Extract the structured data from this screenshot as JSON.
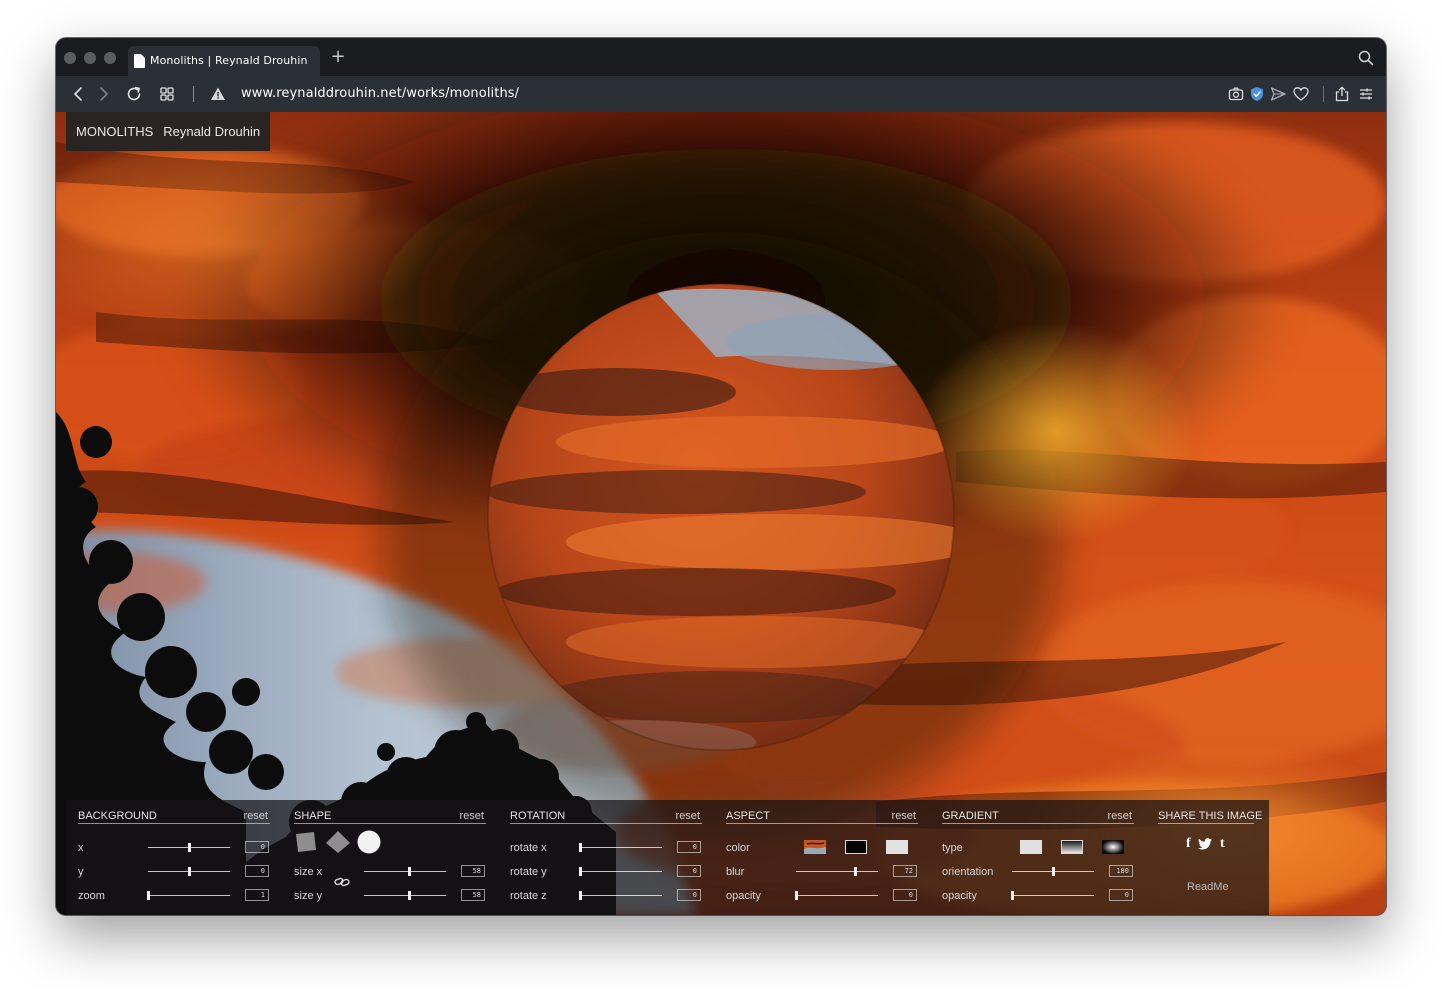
{
  "browser": {
    "tab_title": "Monoliths | Reynald Drouhin",
    "new_tab_label": "+",
    "url": "www.reynalddrouhin.net/works/monoliths/"
  },
  "site": {
    "title": "MONOLITHS",
    "author": "Reynald Drouhin"
  },
  "controls": {
    "background": {
      "title": "BACKGROUND",
      "reset": "reset",
      "rows": [
        {
          "label": "x",
          "value": "0",
          "level": 0.5
        },
        {
          "label": "y",
          "value": "0",
          "level": 0.5
        },
        {
          "label": "zoom",
          "value": "1",
          "level": 0.0
        }
      ]
    },
    "shape": {
      "title": "SHAPE",
      "reset": "reset",
      "shapes": [
        "square",
        "diamond",
        "circle"
      ],
      "selected_shape": "circle",
      "rows": [
        {
          "label": "size x",
          "value": "58",
          "level": 0.55
        },
        {
          "label": "size y",
          "value": "58",
          "level": 0.55
        }
      ]
    },
    "rotation": {
      "title": "ROTATION",
      "reset": "reset",
      "rows": [
        {
          "label": "rotate x",
          "value": "0",
          "level": 0.0
        },
        {
          "label": "rotate y",
          "value": "0",
          "level": 0.0
        },
        {
          "label": "rotate z",
          "value": "0",
          "level": 0.0
        }
      ]
    },
    "aspect": {
      "title": "ASPECT",
      "reset": "reset",
      "color_label": "color",
      "color_options": [
        "image",
        "black",
        "white"
      ],
      "rows": [
        {
          "label": "blur",
          "value": "72",
          "level": 0.72
        },
        {
          "label": "opacity",
          "value": "0",
          "level": 0.0
        }
      ]
    },
    "gradient": {
      "title": "GRADIENT",
      "reset": "reset",
      "type_label": "type",
      "type_options": [
        "flat",
        "linear",
        "radial"
      ],
      "rows": [
        {
          "label": "orientation",
          "value": "180",
          "level": 0.5
        },
        {
          "label": "opacity",
          "value": "0",
          "level": 0.0
        }
      ]
    },
    "share": {
      "title": "SHARE THIS IMAGE",
      "icons": [
        "facebook-icon",
        "twitter-icon",
        "tumblr-icon"
      ],
      "readme": "ReadMe"
    }
  },
  "colors": {
    "sky_orange": "#e0561a",
    "sky_dark": "#1c0d08",
    "sky_blue": "#a9b8c9",
    "panel_bg": "#161416"
  }
}
